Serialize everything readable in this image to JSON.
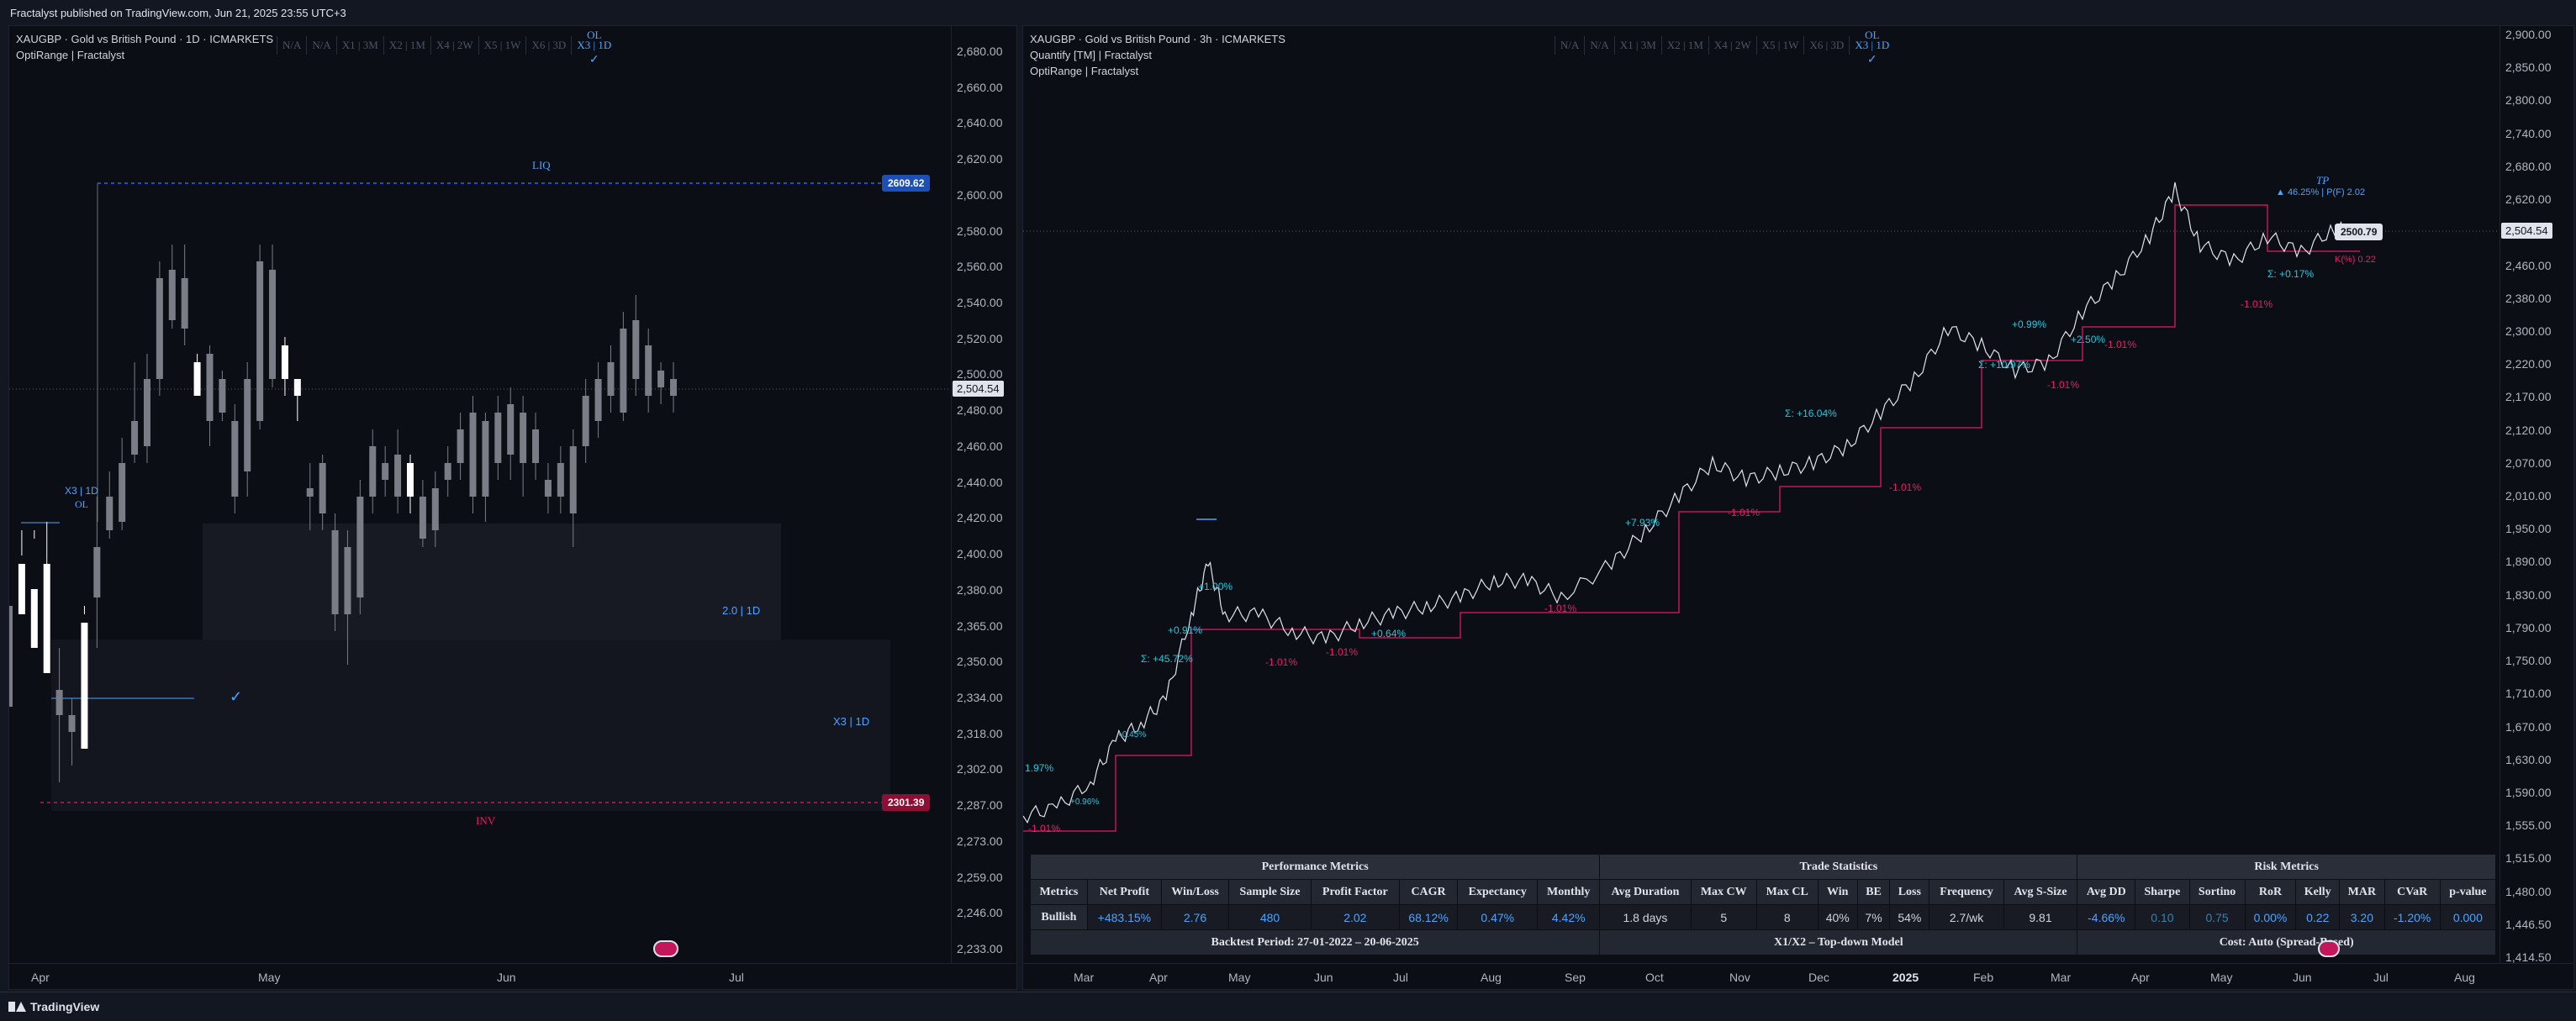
{
  "publisher_line": "Fractalyst published on TradingView.com, Jun 21, 2025 23:55 UTC+3",
  "brand": "TradingView",
  "left_chart": {
    "title": "XAUGBP · Gold vs British Pound · 1D · ICMARKETS",
    "indicator": "OptiRange | Fractalyst",
    "tabs": [
      "N/A",
      "N/A",
      "X1 | 3M",
      "X2 | 1M",
      "X4 | 2W",
      "X5 | 1W",
      "X6 | 3D",
      "X3 | 1D"
    ],
    "active_tab_top": "OL",
    "active_tab_check": "✓",
    "y_ticks": [
      "2,680.00",
      "2,660.00",
      "2,640.00",
      "2,620.00",
      "2,600.00",
      "2,580.00",
      "2,560.00",
      "2,540.00",
      "2,520.00",
      "2,500.00",
      "2,480.00",
      "2,460.00",
      "2,440.00",
      "2,420.00",
      "2,400.00",
      "2,380.00",
      "2,365.00",
      "2,350.00",
      "2,334.00",
      "2,318.00",
      "2,302.00",
      "2,287.00",
      "2,273.00",
      "2,259.00",
      "2,246.00",
      "2,233.00"
    ],
    "x_ticks": [
      "Apr",
      "May",
      "Jun",
      "Jul"
    ],
    "current_price": "2,504.54",
    "liq_price": "2609.62",
    "inv_price": "2301.39",
    "liq_label": "LIQ",
    "inv_label": "INV",
    "x3_label_top": "X3 | 1D",
    "ol_label": "OL",
    "box_2_label": "2.0 | 1D",
    "box_x3_label": "X3 | 1D",
    "check": "✓",
    "colors": {
      "up": "#ffffff",
      "down": "#7a7d85",
      "liq": "#2962ff",
      "inv": "#c2185b",
      "accent": "#4da3ff"
    }
  },
  "right_chart": {
    "title": "XAUGBP · Gold vs British Pound · 3h · ICMARKETS",
    "indicator_1": "Quantify [TM] | Fractalyst",
    "indicator_2": "OptiRange | Fractalyst",
    "tabs": [
      "N/A",
      "N/A",
      "X1 | 3M",
      "X2 | 1M",
      "X4 | 2W",
      "X5 | 1W",
      "X6 | 3D",
      "X3 | 1D"
    ],
    "active_tab_top": "OL",
    "active_tab_check": "✓",
    "y_ticks": [
      "2,900.00",
      "2,850.00",
      "2,800.00",
      "2,740.00",
      "2,680.00",
      "2,620.00",
      "2,540.00",
      "2,460.00",
      "2,380.00",
      "2,300.00",
      "2,220.00",
      "2,170.00",
      "2,120.00",
      "2,070.00",
      "2,010.00",
      "1,950.00",
      "1,890.00",
      "1,830.00",
      "1,790.00",
      "1,750.00",
      "1,710.00",
      "1,670.00",
      "1,630.00",
      "1,590.00",
      "1,555.00",
      "1,515.00",
      "1,480.00",
      "1,446.50",
      "1,414.50"
    ],
    "x_ticks": [
      "Mar",
      "Apr",
      "May",
      "Jun",
      "Jul",
      "Aug",
      "Sep",
      "Oct",
      "Nov",
      "Dec",
      "2025",
      "Feb",
      "Mar",
      "Apr",
      "May",
      "Jun",
      "Jul",
      "Aug"
    ],
    "current_price": "2,504.54",
    "tp_price": "2500.79",
    "tp_label": "TP",
    "tp_stat": "▲ 46.25% | P(F) 2.02",
    "k_stat": "K(%) 0.22",
    "trade_labels_blue": [
      "Σ: +45.72%",
      "Σ: +10.97%",
      "Σ: +16.04%",
      "Σ: +0.17%",
      "+0.91%",
      "+1.00%",
      "+2.50%",
      "+0.99%",
      "+7.93%",
      "+0.64%",
      "+0.45%",
      "+0.96%",
      "1.97%"
    ],
    "trade_labels_pink": [
      "-1.01%",
      "-1.01%",
      "-1.01%",
      "-1.01%",
      "-1.01%",
      "-1.01%",
      "-1.01%",
      "-1.01%",
      "-1.01%"
    ],
    "table": {
      "sections": [
        "Performance Metrics",
        "Trade Statistics",
        "Risk Metrics"
      ],
      "columns": [
        "Metrics",
        "Net Profit",
        "Win/Loss",
        "Sample Size",
        "Profit Factor",
        "CAGR",
        "Expectancy",
        "Monthly",
        "Avg Duration",
        "Max CW",
        "Max CL",
        "Win",
        "BE",
        "Loss",
        "Frequency",
        "Avg S-Size",
        "Avg DD",
        "Sharpe",
        "Sortino",
        "RoR",
        "Kelly",
        "MAR",
        "CVaR",
        "p-value"
      ],
      "row": [
        "Bullish",
        "+483.15%",
        "2.76",
        "480",
        "2.02",
        "68.12%",
        "0.47%",
        "4.42%",
        "1.8 days",
        "5",
        "8",
        "40%",
        "7%",
        "54%",
        "2.7/wk",
        "9.81",
        "-4.66%",
        "0.10",
        "0.75",
        "0.00%",
        "0.22",
        "3.20",
        "-1.20%",
        "0.000"
      ],
      "footer": [
        "Backtest Period: 27-01-2022 – 20-06-2025",
        "X1/X2 – Top-down Model",
        "Cost: Auto (Spread-Based)"
      ]
    }
  }
}
